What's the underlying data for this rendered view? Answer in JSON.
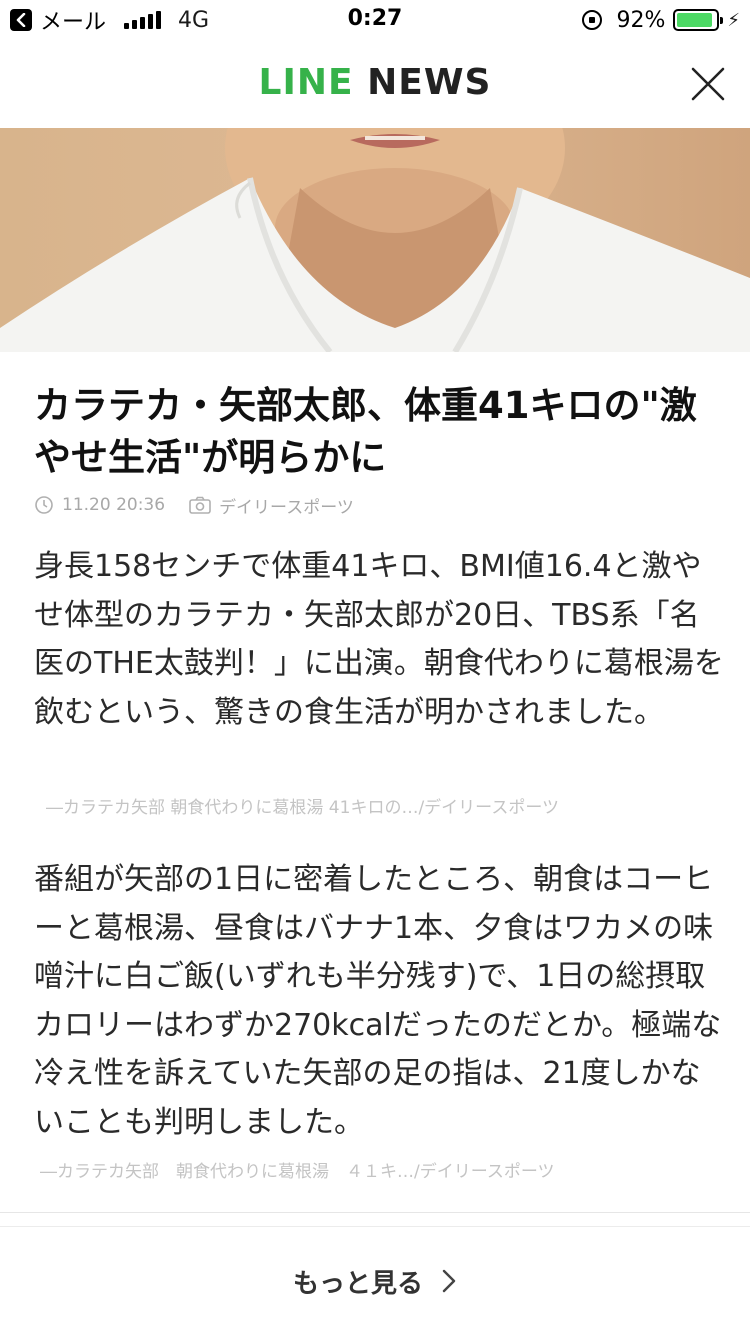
{
  "status_bar": {
    "back_app": "メール",
    "network": "4G",
    "time": "0:27",
    "battery": "92%",
    "battery_level": 0.92
  },
  "header": {
    "logo_line": "LINE",
    "logo_news": "NEWS"
  },
  "article": {
    "title": "カラテカ・矢部太郎、体重41キロの\"激やせ生活\"が明らかに",
    "date": "11.20 20:36",
    "source": "デイリースポーツ",
    "paragraph1": "身長158センチで体重41キロ、BMI値16.4と激やせ体型のカラテカ・矢部太郎が20日、TBS系「名医のTHE太鼓判！」に出演。朝食代わりに葛根湯を飲むという、驚きの食生活が明かされました。",
    "citation1": "―カラテカ矢部 朝食代わりに葛根湯 41キロの…/デイリースポーツ",
    "paragraph2": "番組が矢部の1日に密着したところ、朝食はコーヒーと葛根湯、昼食はバナナ1本、夕食はワカメの味噌汁に白ご飯(いずれも半分残す)で、1日の総摂取カロリーはわずか270kcalだったのだとか。極端な冷え性を訴えていた矢部の足の指は、21度しかないことも判明しました。",
    "citation2": "―カラテカ矢部　朝食代わりに葛根湯　４１キ…/デイリースポーツ"
  },
  "footer": {
    "more_label": "もっと見る"
  },
  "colors": {
    "line_green": "#36b24a",
    "battery_green": "#4cd964",
    "meta_gray": "#a8a8a8"
  }
}
